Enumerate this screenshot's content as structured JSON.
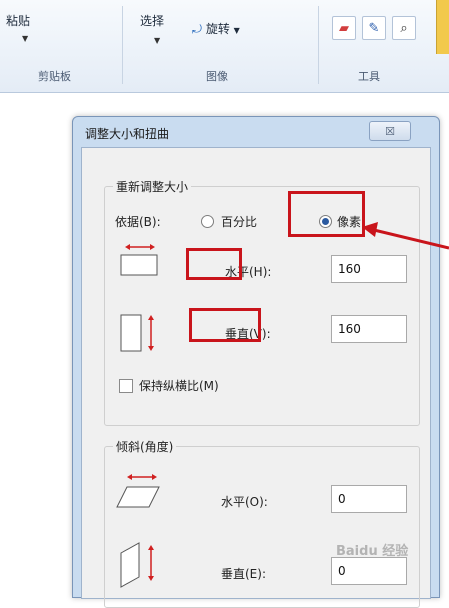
{
  "ribbon": {
    "paste_label": "粘贴",
    "clipboard_group": "剪贴板",
    "select_label": "选择",
    "rotate_label": "旋转",
    "image_group": "图像",
    "tools_group": "工具",
    "icons": [
      "paste-icon",
      "rotate-icon",
      "eraser-icon",
      "color-picker-icon",
      "magnifier-icon"
    ]
  },
  "dialog": {
    "title": "调整大小和扭曲",
    "close_glyph": "☒",
    "resize": {
      "title": "重新调整大小",
      "basis_label": "依据(B):",
      "percent_label": "百分比",
      "pixels_label": "像素",
      "selected": "pixels",
      "horizontal_label": "水平(H):",
      "horizontal_value": "160",
      "vertical_label": "垂直(V):",
      "vertical_value": "160",
      "keep_ratio_label": "保持纵横比(M)",
      "keep_ratio_checked": false
    },
    "skew": {
      "title": "倾斜(角度)",
      "horizontal_label": "水平(O):",
      "horizontal_value": "0",
      "vertical_label": "垂直(E):",
      "vertical_value": "0"
    }
  },
  "annotation": {
    "color": "#c9141b"
  },
  "watermark": "Baidu 经验"
}
